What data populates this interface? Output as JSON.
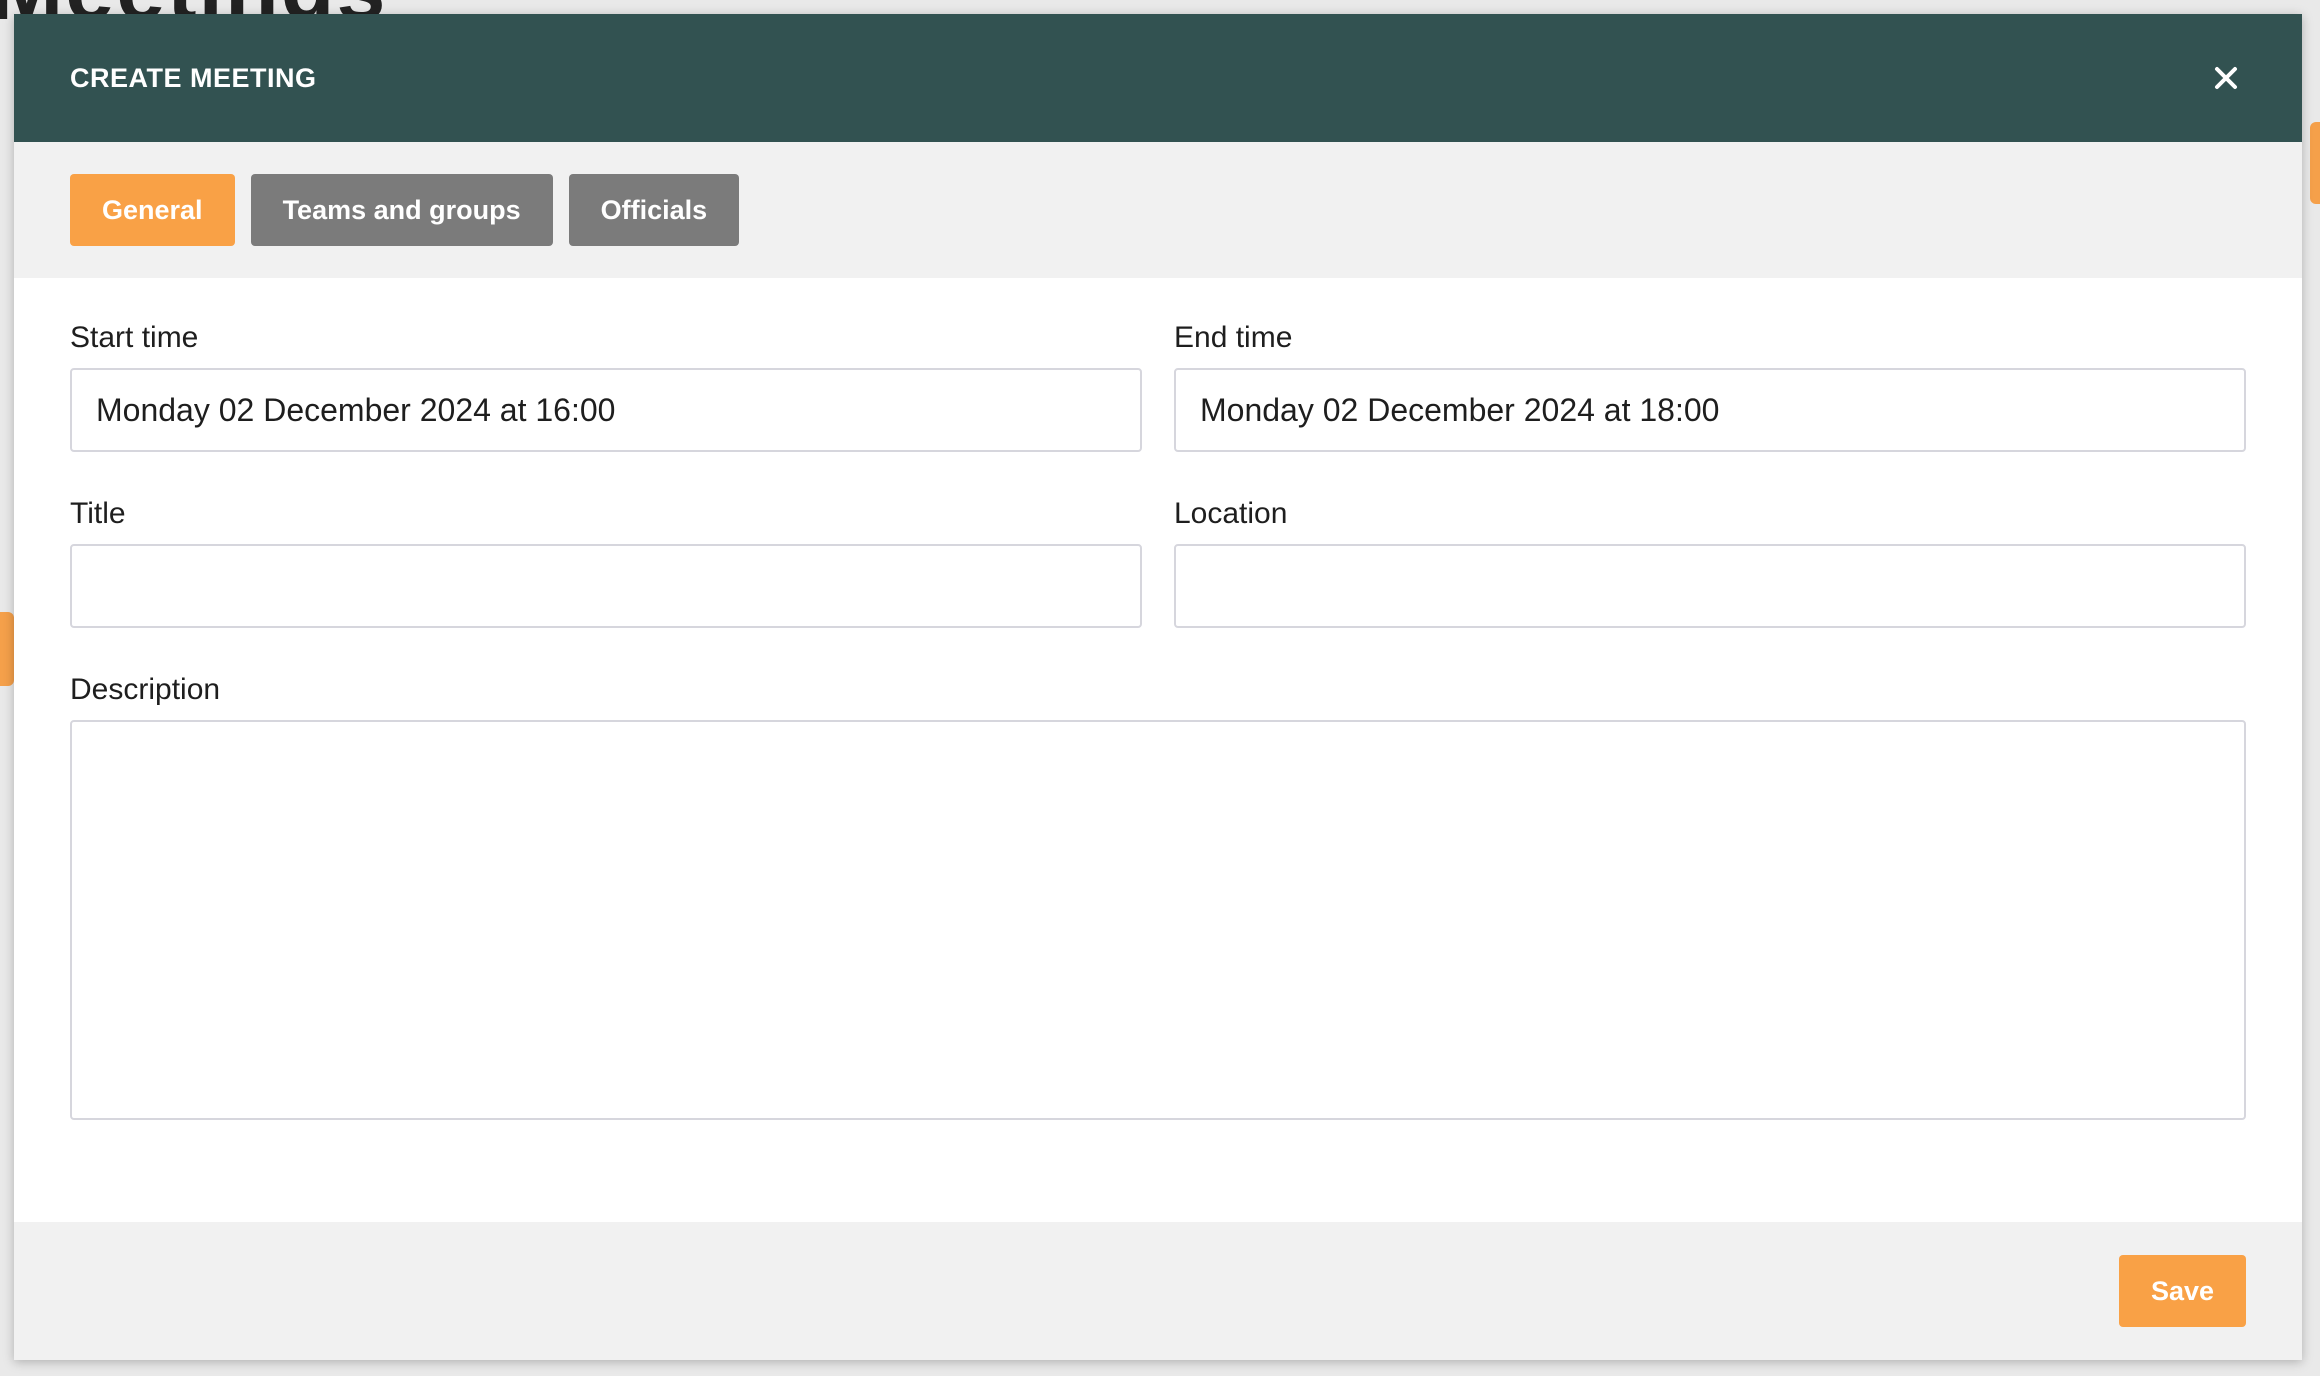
{
  "background": {
    "heading_fragment": "Meetings"
  },
  "modal": {
    "title": "CREATE MEETING",
    "close_icon": "close-icon"
  },
  "tabs": [
    {
      "label": "General",
      "active": true
    },
    {
      "label": "Teams and groups",
      "active": false
    },
    {
      "label": "Officials",
      "active": false
    }
  ],
  "form": {
    "start_time": {
      "label": "Start time",
      "value": "Monday 02 December 2024 at 16:00"
    },
    "end_time": {
      "label": "End time",
      "value": "Monday 02 December 2024 at 18:00"
    },
    "title": {
      "label": "Title",
      "value": ""
    },
    "location": {
      "label": "Location",
      "value": ""
    },
    "description": {
      "label": "Description",
      "value": ""
    }
  },
  "footer": {
    "save_label": "Save"
  },
  "colors": {
    "header_bg": "#325251",
    "accent": "#f9a146",
    "tab_inactive": "#7b7b7b",
    "bar_bg": "#f1f1f1"
  }
}
